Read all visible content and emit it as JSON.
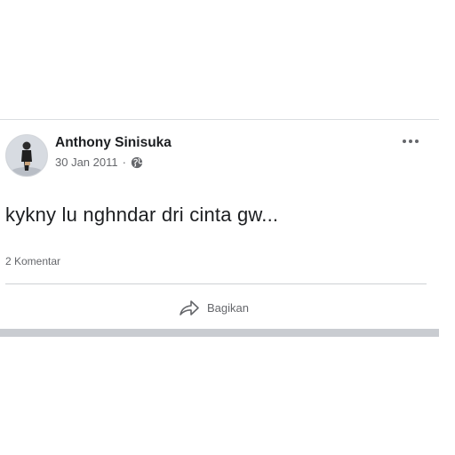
{
  "post": {
    "author": "Anthony Sinisuka",
    "date": "30 Jan 2011",
    "separator": "·",
    "privacy_icon": "globe-icon",
    "text": "kykny lu nghndar dri cinta gw...",
    "comments": "2 Komentar",
    "share_label": "Bagikan"
  },
  "colors": {
    "text_primary": "#1c1e21",
    "text_secondary": "#65676b",
    "divider": "#ced0d4",
    "bottom_bar": "#c9ccd1"
  }
}
